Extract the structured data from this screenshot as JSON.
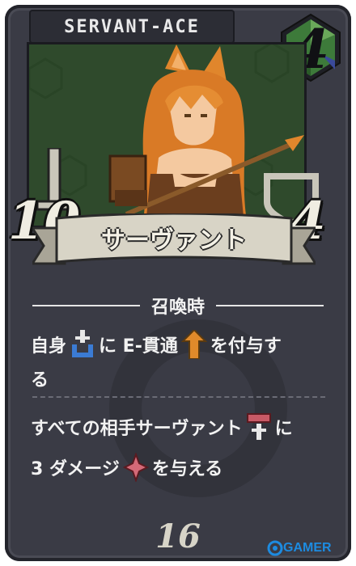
{
  "card": {
    "header_title": "SERVANT-ACE",
    "cost": "4",
    "attack": "10",
    "hp": "4",
    "name": "サーヴァント",
    "power": "16"
  },
  "effect": {
    "trigger": "召喚時",
    "line1_a": "自身",
    "line1_b": "に E-貫通",
    "line1_c": "を付与す",
    "line2": "る",
    "line3_a": "すべての相手サーヴァント",
    "line3_b": "に",
    "line4_a": "3 ダメージ",
    "line4_b": "を与える"
  },
  "watermark": {
    "brand": "GAMER"
  },
  "icons": [
    "sword-self-icon",
    "piercing-arrow-icon",
    "enemy-servant-icon",
    "damage-burst-icon"
  ],
  "colors": {
    "card_frame": "#3a3b45",
    "art_bg": "#2f4a2c",
    "hair": "#e0862c",
    "cost_gem": "#3d7a3a",
    "text": "#f2f2f2",
    "brand": "#1d8be0"
  }
}
